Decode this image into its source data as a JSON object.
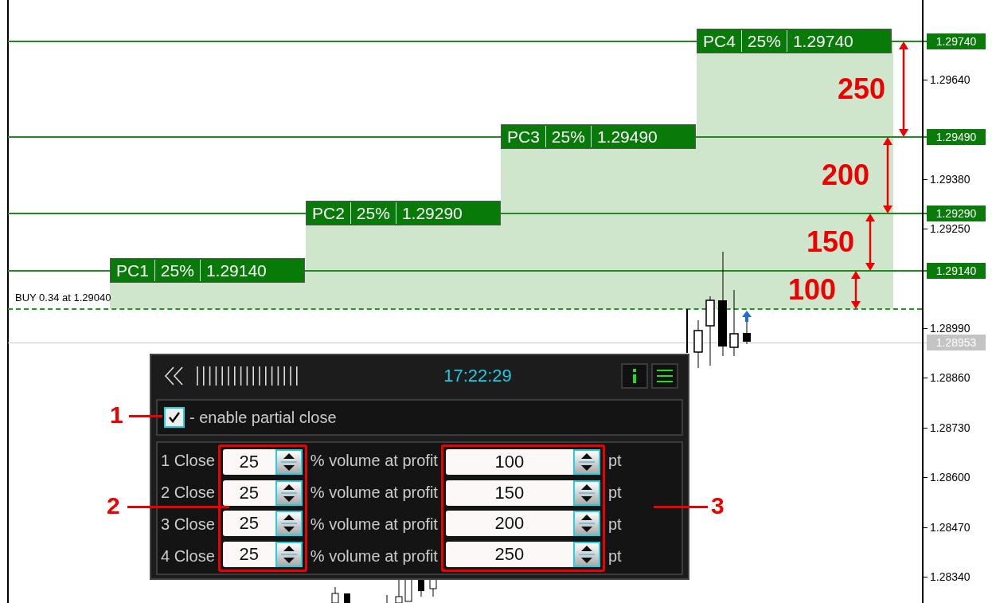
{
  "chart": {
    "levels": [
      {
        "name": "PC4",
        "percent": "25%",
        "price": "1.29740",
        "axis_label": "1.29740",
        "distance": "250"
      },
      {
        "name": "PC3",
        "percent": "25%",
        "price": "1.29490",
        "axis_label": "1.29490",
        "distance": "200"
      },
      {
        "name": "PC2",
        "percent": "25%",
        "price": "1.29290",
        "axis_label": "1.29290",
        "distance": "150"
      },
      {
        "name": "PC1",
        "percent": "25%",
        "price": "1.29140",
        "axis_label": "1.29140",
        "distance": "100"
      }
    ],
    "entry": {
      "text": "BUY 0.34 at 1.29040"
    },
    "current_price": "1.28953",
    "axis_ticks": [
      "1.29640",
      "1.29380",
      "1.29250",
      "1.28990",
      "1.28860",
      "1.28730",
      "1.28600",
      "1.28470",
      "1.28340"
    ]
  },
  "panel": {
    "time": "17:22:29",
    "enable": {
      "checked": true,
      "label": "- enable partial close"
    },
    "rows": [
      {
        "label": "1 Close",
        "volume": "25",
        "text": "% volume at profit",
        "profit": "100",
        "unit": "pt"
      },
      {
        "label": "2 Close",
        "volume": "25",
        "text": "% volume at profit",
        "profit": "150",
        "unit": "pt"
      },
      {
        "label": "3 Close",
        "volume": "25",
        "text": "% volume at profit",
        "profit": "200",
        "unit": "pt"
      },
      {
        "label": "4 Close",
        "volume": "25",
        "text": "% volume at profit",
        "profit": "250",
        "unit": "pt"
      }
    ]
  },
  "markers": [
    {
      "text": "1"
    },
    {
      "text": "2"
    },
    {
      "text": "3"
    }
  ]
}
